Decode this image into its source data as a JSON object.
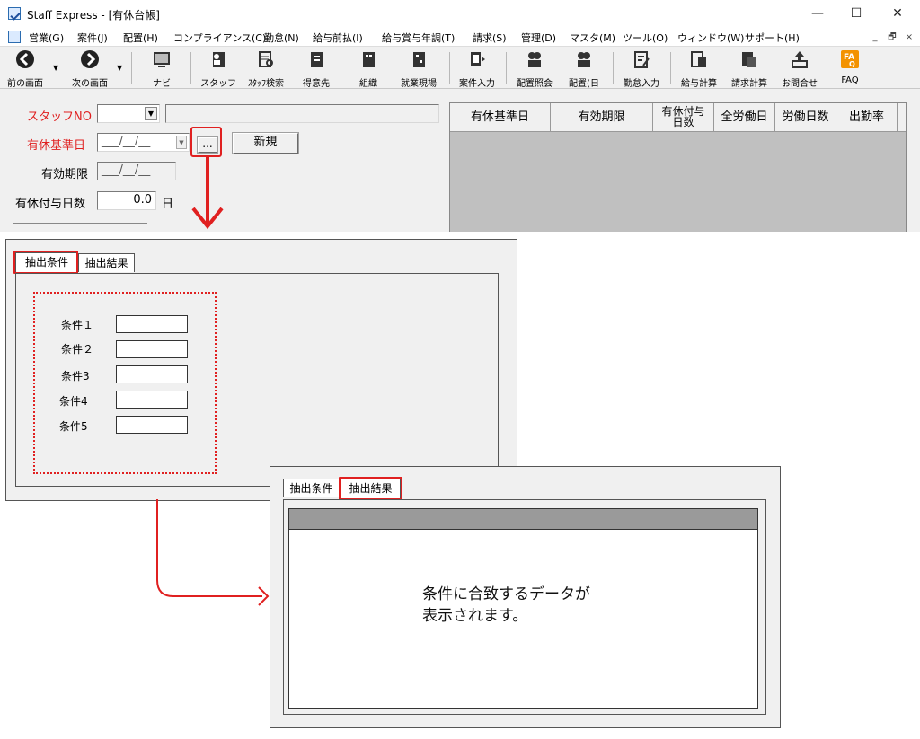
{
  "window": {
    "title": "Staff Express - [有休台帳]",
    "controls": [
      "—",
      "☐",
      "✕"
    ],
    "mdi_controls": [
      "_",
      "🗗",
      "×"
    ]
  },
  "menu": [
    "営業(G)",
    "案件(J)",
    "配置(H)",
    "コンプライアンス(C)",
    "勤怠(N)",
    "給与前払(I)",
    "給与賞与年調(T)",
    "請求(S)",
    "管理(D)",
    "マスタ(M)",
    "ツール(O)",
    "ウィンドウ(W)",
    "サポート(H)"
  ],
  "toolbar": {
    "items": [
      {
        "label": "前の画面",
        "icon": "back-arrow-icon"
      },
      {
        "label": "次の画面",
        "icon": "forward-arrow-icon"
      },
      {
        "label": "ナビ",
        "icon": "navi-icon"
      },
      {
        "label": "スタッフ",
        "icon": "staff-icon"
      },
      {
        "label": "ｽﾀｯﾌ検索",
        "icon": "staff-search-icon"
      },
      {
        "label": "得意先",
        "icon": "client-icon"
      },
      {
        "label": "組織",
        "icon": "organization-icon"
      },
      {
        "label": "就業現場",
        "icon": "worksite-icon"
      },
      {
        "label": "案件入力",
        "icon": "case-input-icon"
      },
      {
        "label": "配置照会",
        "icon": "placement-inquiry-icon"
      },
      {
        "label": "配置(日",
        "icon": "placement-daily-icon"
      },
      {
        "label": "勤怠入力",
        "icon": "attendance-input-icon"
      },
      {
        "label": "給与計算",
        "icon": "payroll-icon"
      },
      {
        "label": "請求計算",
        "icon": "billing-icon"
      },
      {
        "label": "お問合せ",
        "icon": "inquiry-icon"
      },
      {
        "label": "FAQ",
        "icon": "faq-icon"
      }
    ]
  },
  "form": {
    "staff_no_label": "スタッフNO",
    "base_date_label": "有休基準日",
    "date_placeholder": "___/__/__",
    "ellipsis_label": "...",
    "new_button": "新規",
    "valid_until_label": "有効期限",
    "grant_days_label": "有休付与日数",
    "grant_days_value": "0.0",
    "grant_days_unit": "日"
  },
  "grid": {
    "headers": [
      "有休基準日",
      "有効期限",
      "有休付与日数",
      "全労働日",
      "労働日数",
      "出勤率"
    ]
  },
  "search_panel": {
    "tabs": [
      "抽出条件",
      "抽出結果"
    ],
    "conditions": [
      "条件１",
      "条件２",
      "条件3",
      "条件4",
      "条件5"
    ]
  },
  "result_panel": {
    "tabs": [
      "抽出条件",
      "抽出結果"
    ],
    "message": "条件に合致するデータが\n表示されます。"
  },
  "colors": {
    "highlight": "#e02020",
    "result_header": "#9a9a9a",
    "grid_bg": "#c0c0c0"
  }
}
